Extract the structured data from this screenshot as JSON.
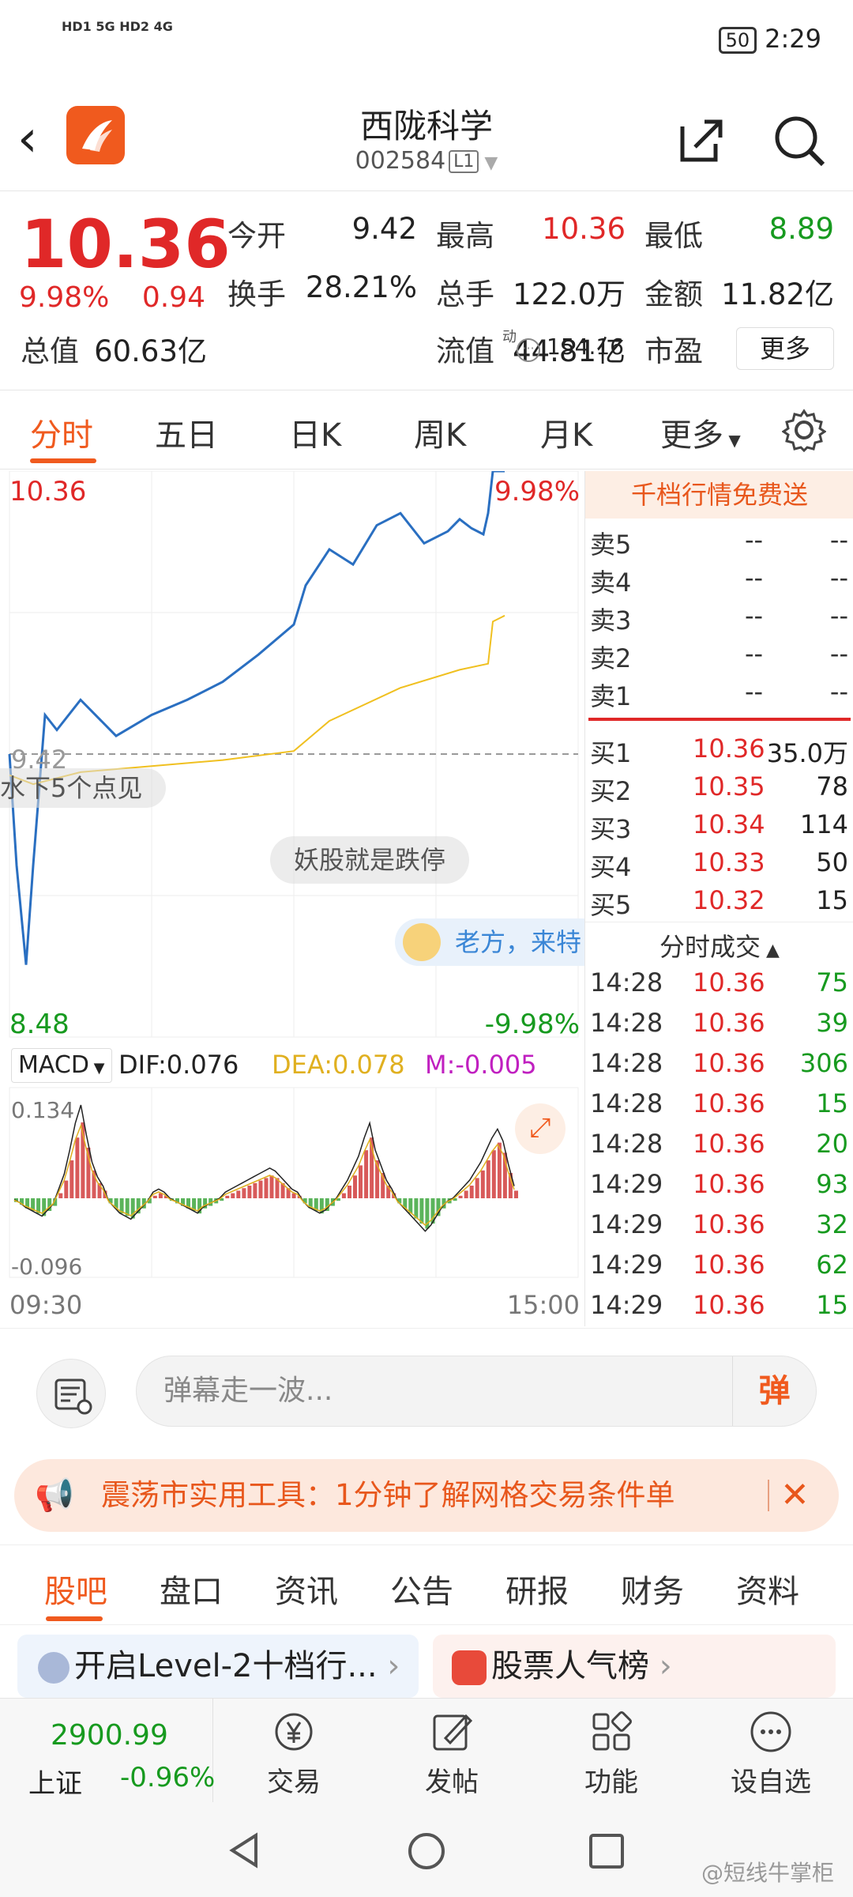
{
  "status_bar": {
    "signal": "HD1 5G  HD2 4G",
    "battery": "50",
    "time": "2:29"
  },
  "header": {
    "title": "西陇科学",
    "code": "002584",
    "level": "L1"
  },
  "quote": {
    "price": "10.36",
    "change_pct": "9.98%",
    "change": "0.94",
    "rows": [
      [
        {
          "l": "今开",
          "v": "9.42",
          "c": "#222"
        },
        {
          "l": "最高",
          "v": "10.36",
          "c": "#e02828"
        },
        {
          "l": "最低",
          "v": "8.89",
          "c": "#179a1f"
        }
      ],
      [
        {
          "l": "换手",
          "v": "28.21%",
          "c": "#222"
        },
        {
          "l": "总手",
          "v": "122.0万",
          "c": "#222"
        },
        {
          "l": "金额",
          "v": "11.82亿",
          "c": "#222"
        }
      ],
      [
        {
          "l": "总值",
          "v": "60.63亿",
          "c": "#222"
        },
        {
          "l": "流值",
          "v": "44.81亿",
          "c": "#222"
        },
        {
          "l": "市盈",
          "v": "154.16",
          "c": "#222"
        }
      ]
    ],
    "pe_badge": "动",
    "more_label": "更多"
  },
  "tabs": [
    "分时",
    "五日",
    "日K",
    "周K",
    "月K",
    "更多"
  ],
  "chart": {
    "y_top": "10.36",
    "y_top_pct": "9.98%",
    "y_bottom": "8.48",
    "y_bottom_pct": "-9.98%",
    "ref_price": "9.42",
    "bubbles": [
      "水下5个点见",
      "妖股就是跌停",
      "老方，来特"
    ],
    "macd": {
      "label": "MACD",
      "dif": "DIF:0.076",
      "dea": "DEA:0.078",
      "m": "M:-0.005",
      "max": "0.134",
      "min": "-0.096"
    },
    "time_start": "09:30",
    "time_end": "15:00"
  },
  "chart_data": {
    "type": "line",
    "title": "",
    "x_range": [
      "09:30",
      "15:00"
    ],
    "ylim": [
      8.48,
      10.36
    ],
    "prev_close": 9.42,
    "series": [
      {
        "name": "",
        "x": [
          "09:30",
          "09:33",
          "09:37",
          "09:40",
          "09:45",
          "09:50",
          "10:00",
          "10:15",
          "10:30",
          "10:45",
          "11:00",
          "11:15",
          "11:30",
          "13:05",
          "13:15",
          "13:25",
          "13:35",
          "13:45",
          "13:55",
          "14:05",
          "14:10",
          "14:15",
          "14:20",
          "14:22",
          "14:24",
          "14:29"
        ],
        "values": [
          9.42,
          9.05,
          8.72,
          9.05,
          9.55,
          9.5,
          9.6,
          9.48,
          9.55,
          9.6,
          9.66,
          9.75,
          9.85,
          9.98,
          10.1,
          10.05,
          10.18,
          10.22,
          10.12,
          10.16,
          10.2,
          10.17,
          10.15,
          10.22,
          10.36,
          10.36
        ]
      },
      {
        "name": "",
        "x": [
          "09:30",
          "09:40",
          "10:00",
          "10:30",
          "11:00",
          "11:30",
          "13:15",
          "13:45",
          "14:10",
          "14:22",
          "14:24",
          "14:29"
        ],
        "values": [
          9.35,
          9.32,
          9.36,
          9.38,
          9.4,
          9.43,
          9.53,
          9.64,
          9.7,
          9.72,
          9.86,
          9.88
        ]
      }
    ]
  },
  "order_book": {
    "free_label": "千档行情免费送",
    "asks": [
      {
        "l": "卖5",
        "p": "--",
        "v": "--"
      },
      {
        "l": "卖4",
        "p": "--",
        "v": "--"
      },
      {
        "l": "卖3",
        "p": "--",
        "v": "--"
      },
      {
        "l": "卖2",
        "p": "--",
        "v": "--"
      },
      {
        "l": "卖1",
        "p": "--",
        "v": "--"
      }
    ],
    "bids": [
      {
        "l": "买1",
        "p": "10.36",
        "v": "35.0万"
      },
      {
        "l": "买2",
        "p": "10.35",
        "v": "78"
      },
      {
        "l": "买3",
        "p": "10.34",
        "v": "114"
      },
      {
        "l": "买4",
        "p": "10.33",
        "v": "50"
      },
      {
        "l": "买5",
        "p": "10.32",
        "v": "15"
      }
    ],
    "trades_label": "分时成交",
    "trades": [
      {
        "t": "14:28",
        "p": "10.36",
        "v": "75"
      },
      {
        "t": "14:28",
        "p": "10.36",
        "v": "39"
      },
      {
        "t": "14:28",
        "p": "10.36",
        "v": "306"
      },
      {
        "t": "14:28",
        "p": "10.36",
        "v": "15"
      },
      {
        "t": "14:28",
        "p": "10.36",
        "v": "20"
      },
      {
        "t": "14:29",
        "p": "10.36",
        "v": "93"
      },
      {
        "t": "14:29",
        "p": "10.36",
        "v": "32"
      },
      {
        "t": "14:29",
        "p": "10.36",
        "v": "62"
      },
      {
        "t": "14:29",
        "p": "10.36",
        "v": "15"
      }
    ]
  },
  "danmaku": {
    "placeholder": "弹幕走一波...",
    "send": "弹"
  },
  "banner": {
    "text": "震荡市实用工具：1分钟了解网格交易条件单"
  },
  "sub_tabs": [
    "股吧",
    "盘口",
    "资讯",
    "公告",
    "研报",
    "财务",
    "资料"
  ],
  "cards": [
    {
      "label": "开启Level-2十档行..."
    },
    {
      "label": "股票人气榜"
    }
  ],
  "bottom_nav": {
    "index_value": "2900.99",
    "index_name": "上证",
    "index_pct": "-0.96%",
    "items": [
      "交易",
      "发帖",
      "功能",
      "设自选"
    ]
  },
  "watermark": "@短线牛掌柜",
  "colors": {
    "up": "#e02828",
    "down": "#179a1f",
    "accent": "#f05a1e",
    "price_line": "#2a6fc1",
    "avg_line": "#f0c020"
  }
}
